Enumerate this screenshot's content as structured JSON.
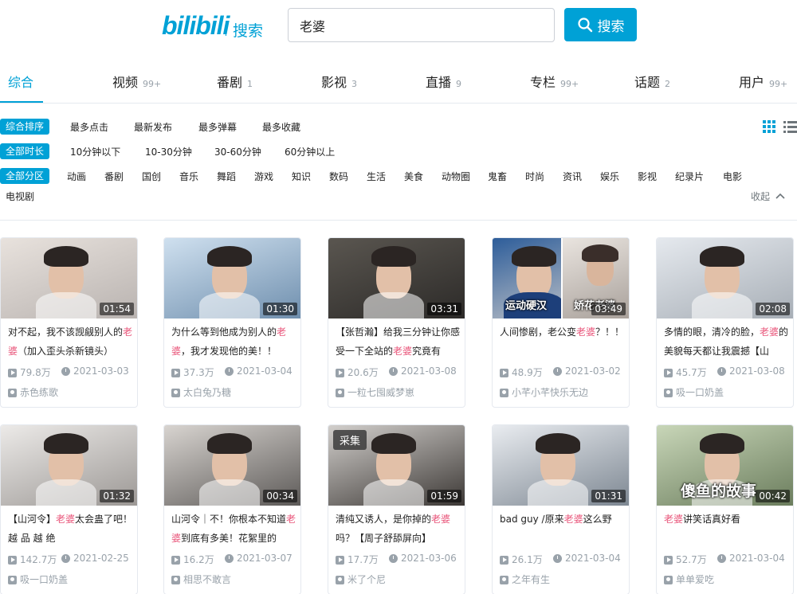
{
  "header": {
    "logo_text": "bilibili",
    "logo_sub": "搜索",
    "search_value": "老婆",
    "search_button": "搜索"
  },
  "tabs": [
    {
      "label": "综合",
      "count": ""
    },
    {
      "label": "视频",
      "count": "99+"
    },
    {
      "label": "番剧",
      "count": "1"
    },
    {
      "label": "影视",
      "count": "3"
    },
    {
      "label": "直播",
      "count": "9"
    },
    {
      "label": "专栏",
      "count": "99+"
    },
    {
      "label": "话题",
      "count": "2"
    },
    {
      "label": "用户",
      "count": "99+"
    }
  ],
  "filters": {
    "order": {
      "selected": "综合排序",
      "options": [
        "最多点击",
        "最新发布",
        "最多弹幕",
        "最多收藏"
      ]
    },
    "duration": {
      "selected": "全部时长",
      "options": [
        "10分钟以下",
        "10-30分钟",
        "30-60分钟",
        "60分钟以上"
      ]
    },
    "zone": {
      "selected": "全部分区",
      "options": [
        "动画",
        "番剧",
        "国创",
        "音乐",
        "舞蹈",
        "游戏",
        "知识",
        "数码",
        "生活",
        "美食",
        "动物圈",
        "鬼畜",
        "时尚",
        "资讯",
        "娱乐",
        "影视",
        "纪录片",
        "电影",
        "电视剧"
      ]
    },
    "collapse_label": "收起"
  },
  "videos": [
    {
      "title_parts": [
        "对不起，我不该觊觎别人的",
        "老婆",
        "（加入歪头杀新镜头）"
      ],
      "duration": "01:54",
      "views": "79.8万",
      "date": "2021-03-03",
      "uploader": "赤色练歌",
      "colors": [
        "#e8e2dd",
        "#b9b3b0"
      ]
    },
    {
      "title_parts": [
        "为什么等到他成为别人的",
        "老婆",
        "，我才发现他的美！！"
      ],
      "duration": "01:30",
      "views": "37.3万",
      "date": "2021-03-04",
      "uploader": "太白兔乃糖",
      "colors": [
        "#cfe0ef",
        "#6f8fae"
      ]
    },
    {
      "title_parts": [
        "【张哲瀚】给我三分钟让你感受一下全站的",
        "老婆",
        "究竟有"
      ],
      "duration": "03:31",
      "views": "20.6万",
      "date": "2021-03-08",
      "uploader": "一粒七囤威梦崽",
      "colors": [
        "#5a5650",
        "#2c2a28"
      ]
    },
    {
      "title_parts": [
        "人间惨剧，老公变",
        "老婆",
        "？！！"
      ],
      "duration": "03:49",
      "views": "48.9万",
      "date": "2021-03-02",
      "uploader": "小芊小芊快乐无边",
      "colors": [
        "#2d5d9a",
        "#d9d4cf"
      ],
      "captions": [
        "运动硬汉",
        "娇花老婆"
      ]
    },
    {
      "title_parts": [
        "多情的眼，清冷的脸，",
        "老婆",
        "的美貌每天都让我震撼【山"
      ],
      "duration": "02:08",
      "views": "45.7万",
      "date": "2021-03-08",
      "uploader": "吸一口奶盖",
      "colors": [
        "#e5e9ee",
        "#a7aeb6"
      ]
    },
    {
      "title_parts": [
        "【山河令】",
        "老婆",
        "太会蛊了吧！越 品 越 绝"
      ],
      "duration": "01:32",
      "views": "142.7万",
      "date": "2021-02-25",
      "uploader": "吸一口奶盖",
      "colors": [
        "#eceae8",
        "#9c9895"
      ]
    },
    {
      "title_parts": [
        "山河令｜不！你根本不知道",
        "老婆",
        "到底有多美！花絮里的"
      ],
      "duration": "00:34",
      "views": "16.2万",
      "date": "2021-03-07",
      "uploader": "相思不敢言",
      "colors": [
        "#d8d4d0",
        "#5d5a58"
      ]
    },
    {
      "title_parts": [
        "清纯又诱人，是你掉的",
        "老婆",
        "吗？【周子舒舔屏向】"
      ],
      "duration": "01:59",
      "views": "17.7万",
      "date": "2021-03-06",
      "uploader": "米了个尼",
      "colors": [
        "#d2cfcc",
        "#3c3835"
      ],
      "badge": "采集"
    },
    {
      "title_parts": [
        "bad guy /原来",
        "老婆",
        "这么野"
      ],
      "duration": "01:31",
      "views": "26.1万",
      "date": "2021-03-04",
      "uploader": "之年有生",
      "colors": [
        "#e9ecf0",
        "#7d8792"
      ]
    },
    {
      "title_parts": [
        "",
        "老婆",
        "讲笑话真好看"
      ],
      "duration": "00:42",
      "views": "52.7万",
      "date": "2021-03-04",
      "uploader": "单单爱吃",
      "colors": [
        "#c8d6b8",
        "#6b7d5d"
      ],
      "captions": [
        "傻鱼的故事"
      ]
    }
  ]
}
